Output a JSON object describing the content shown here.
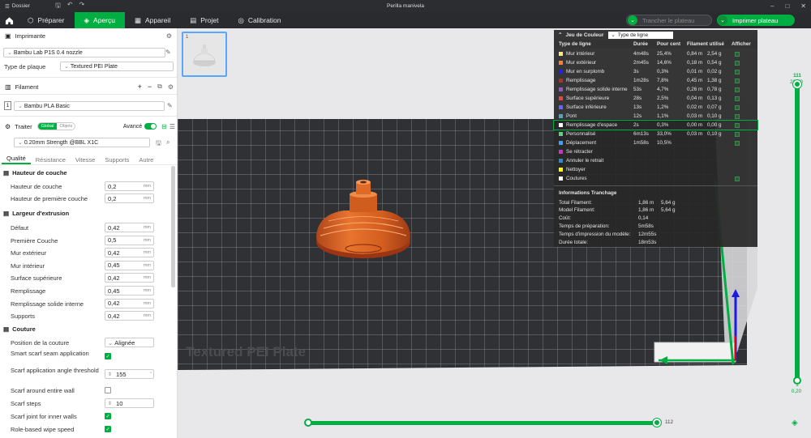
{
  "titlebar": {
    "menu_label": "Dossier",
    "title": "Perilla manivela"
  },
  "tabs": [
    {
      "label": "Préparer"
    },
    {
      "label": "Aperçu"
    },
    {
      "label": "Appareil"
    },
    {
      "label": "Projet"
    },
    {
      "label": "Calibration"
    }
  ],
  "actions": {
    "slice": "Trancher le plateau",
    "print": "Imprimer plateau"
  },
  "printer": {
    "section": "Imprimante",
    "name": "Bambu Lab P1S 0.4 nozzle",
    "plate_label": "Type de plaque",
    "plate_value": "Textured PEI Plate"
  },
  "filament": {
    "section": "Filament",
    "slot": "1",
    "name": "Bambu PLA Basic"
  },
  "process": {
    "section": "Traiter",
    "toggle_on": "Global",
    "toggle_off": "Objets",
    "advanced": "Avancé",
    "profile": "0.20mm Strength @BBL X1C"
  },
  "subtabs": [
    "Qualité",
    "Résistance",
    "Vitesse",
    "Supports",
    "Autre"
  ],
  "groups": {
    "layer": {
      "title": "Hauteur de couche",
      "rows": [
        {
          "label": "Hauteur de couche",
          "value": "0,2",
          "unit": "mm"
        },
        {
          "label": "Hauteur de première couche",
          "value": "0,2",
          "unit": "mm"
        }
      ]
    },
    "width": {
      "title": "Largeur d'extrusion",
      "rows": [
        {
          "label": "Défaut",
          "value": "0,42",
          "unit": "mm"
        },
        {
          "label": "Première Couche",
          "value": "0,5",
          "unit": "mm"
        },
        {
          "label": "Mur extérieur",
          "value": "0,42",
          "unit": "mm"
        },
        {
          "label": "Mur intérieur",
          "value": "0,45",
          "unit": "mm"
        },
        {
          "label": "Surface supérieure",
          "value": "0,42",
          "unit": "mm"
        },
        {
          "label": "Remplissage",
          "value": "0,45",
          "unit": "mm"
        },
        {
          "label": "Remplissage solide interne",
          "value": "0,42",
          "unit": "mm"
        },
        {
          "label": "Supports",
          "value": "0,42",
          "unit": "mm"
        }
      ]
    },
    "seam": {
      "title": "Couture",
      "pos_label": "Position de la couture",
      "pos_value": "Alignée",
      "smart_label": "Smart scarf seam application",
      "angle_label": "Scarf application angle threshold",
      "angle_value": "155",
      "around_label": "Scarf around entire wall",
      "steps_label": "Scarf steps",
      "steps_value": "10",
      "inner_label": "Scarf joint for inner walls",
      "wipe_label": "Role-based wipe speed"
    }
  },
  "legend": {
    "title": "Jeu de Couleur",
    "dropdown": "Type de ligne",
    "headers": {
      "type": "Type de ligne",
      "time": "Durée",
      "pct": "Pour cent",
      "fil": "Filament utilisé",
      "show": "Afficher"
    },
    "rows": [
      {
        "name": "Mur intérieur",
        "color": "#ffe680",
        "time": "4m48s",
        "pct": "25,4%",
        "len": "0,84 m",
        "g": "2,54 g"
      },
      {
        "name": "Mur extérieur",
        "color": "#ff7d38",
        "time": "2m45s",
        "pct": "14,6%",
        "len": "0,18 m",
        "g": "0,54 g"
      },
      {
        "name": "Mur en surplomb",
        "color": "#2020ff",
        "time": "3s",
        "pct": "0,3%",
        "len": "0,01 m",
        "g": "0,02 g"
      },
      {
        "name": "Remplissage",
        "color": "#b03029",
        "time": "1m28s",
        "pct": "7,8%",
        "len": "0,45 m",
        "g": "1,38 g"
      },
      {
        "name": "Remplissage solide interne",
        "color": "#9654cc",
        "time": "53s",
        "pct": "4,7%",
        "len": "0,26 m",
        "g": "0,78 g"
      },
      {
        "name": "Surface supérieure",
        "color": "#f04040",
        "time": "28s",
        "pct": "2,5%",
        "len": "0,04 m",
        "g": "0,13 g"
      },
      {
        "name": "Surface inférieure",
        "color": "#6666ff",
        "time": "13s",
        "pct": "1,2%",
        "len": "0,02 m",
        "g": "0,07 g"
      },
      {
        "name": "Pont",
        "color": "#4da6ba",
        "time": "12s",
        "pct": "1,1%",
        "len": "0,03 m",
        "g": "0,10 g"
      },
      {
        "name": "Remplissage d'espace",
        "color": "#ffffff",
        "time": "2s",
        "pct": "0,3%",
        "len": "0,00 m",
        "g": "0,00 g"
      },
      {
        "name": "Personnalisé",
        "color": "#5ad185",
        "time": "6m13s",
        "pct": "33,0%",
        "len": "0,03 m",
        "g": "0,10 g"
      },
      {
        "name": "Déplacement",
        "color": "#38a0ff",
        "time": "1m58s",
        "pct": "10,5%",
        "len": "",
        "g": ""
      },
      {
        "name": "Se rétracter",
        "color": "#cc30cc",
        "time": "",
        "pct": "",
        "len": "",
        "g": ""
      },
      {
        "name": "Annuler le retrait",
        "color": "#1f8fcf",
        "time": "",
        "pct": "",
        "len": "",
        "g": ""
      },
      {
        "name": "Nettoyer",
        "color": "#ffff00",
        "time": "",
        "pct": "",
        "len": "",
        "g": ""
      },
      {
        "name": "Coutures",
        "color": "#ffffff",
        "time": "",
        "pct": "",
        "len": "",
        "g": ""
      }
    ],
    "info_title": "Informations Tranchage",
    "info": [
      {
        "label": "Total Filament:",
        "v1": "1,86 m",
        "v2": "5,64 g"
      },
      {
        "label": "Model Filament:",
        "v1": "1,86 m",
        "v2": "5,64 g"
      },
      {
        "label": "Coût:",
        "v1": "0,14",
        "v2": ""
      },
      {
        "label": "Temps de préparation:",
        "v1": "5m58s",
        "v2": ""
      },
      {
        "label": "Temps d'impression du modèle:",
        "v1": "12m55s",
        "v2": ""
      },
      {
        "label": "Durée totale:",
        "v1": "18m53s",
        "v2": ""
      }
    ]
  },
  "plate_text": "Textured PEI Plate",
  "thumb_index": "1",
  "layers": {
    "top_layer": "111",
    "top_height": "22,20",
    "bottom_layer": "1",
    "bottom_height": "0,20",
    "hslider_value": "112",
    "range_fraction": 1.0
  }
}
